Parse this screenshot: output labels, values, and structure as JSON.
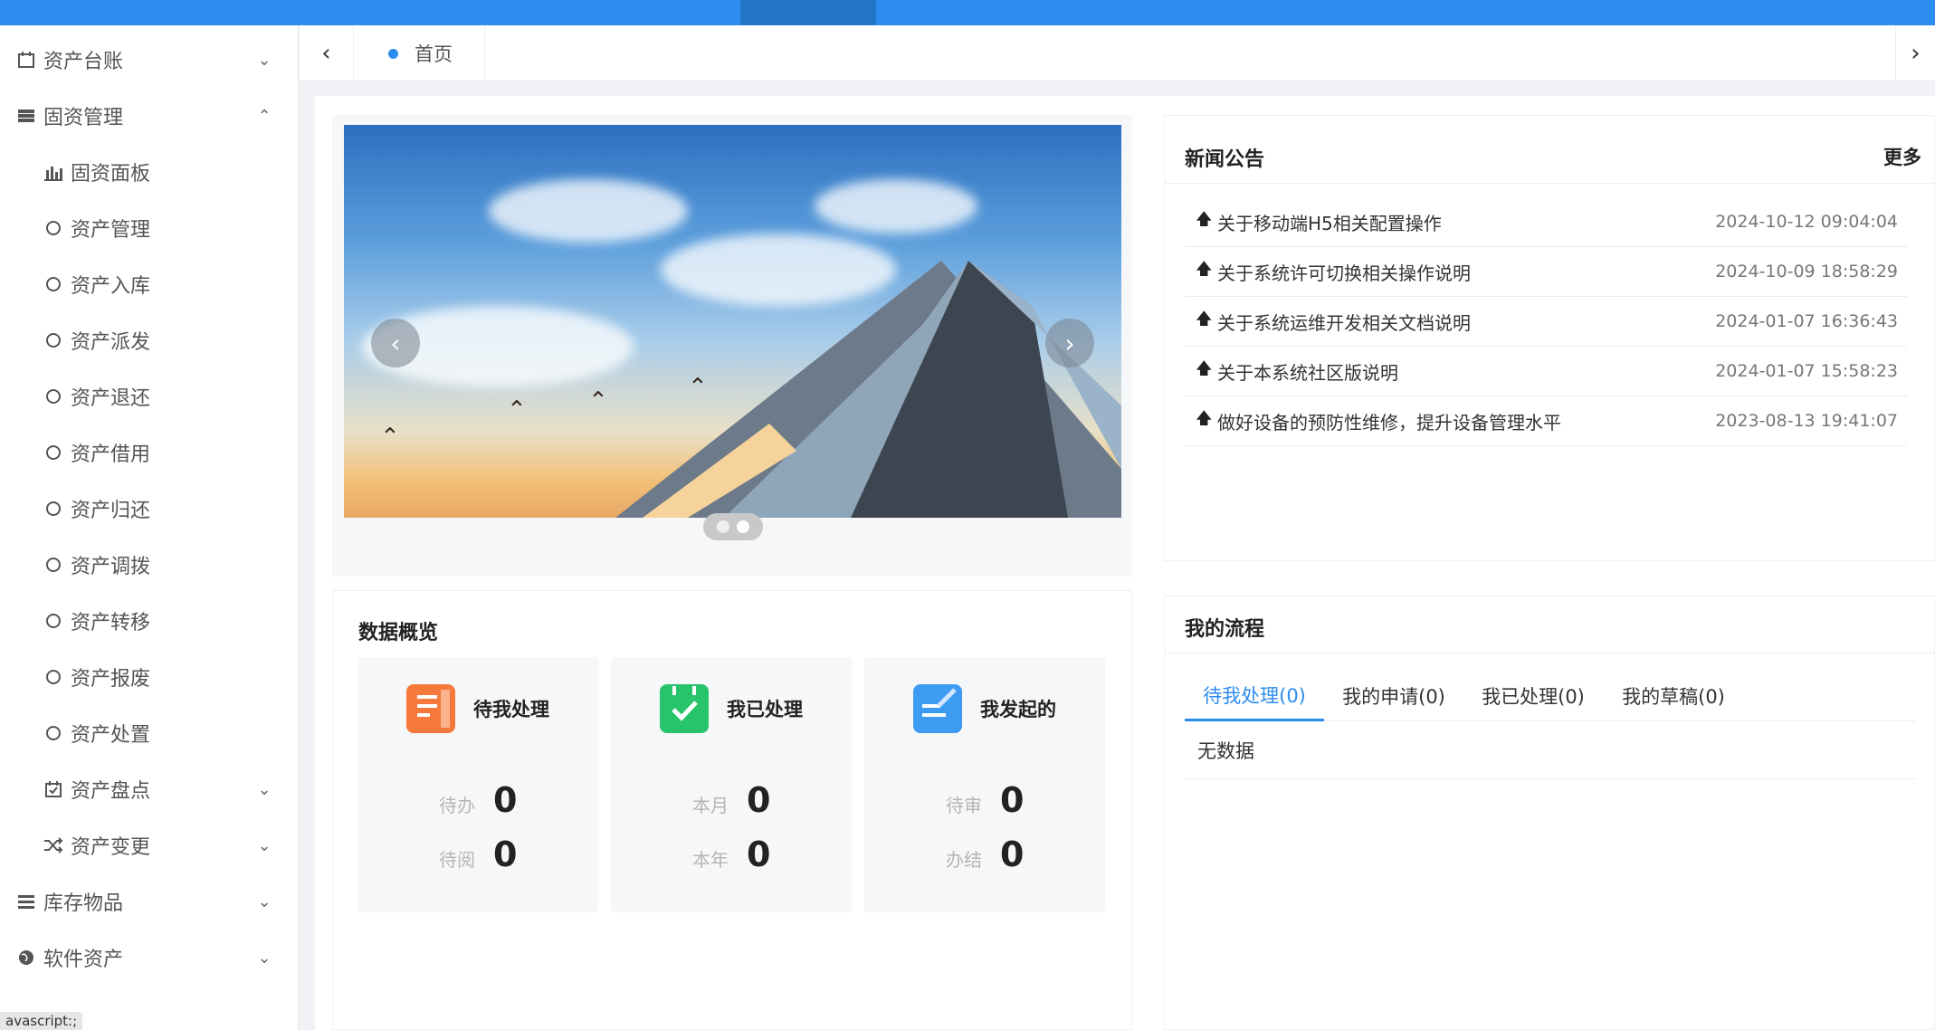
{
  "sidebar": {
    "items": [
      {
        "label": "资产台账",
        "icon": "calendar-icon",
        "expanded": false
      },
      {
        "label": "固资管理",
        "icon": "server-icon",
        "expanded": true
      },
      {
        "label": "固资面板",
        "icon": "bar-chart-icon"
      },
      {
        "label": "资产管理",
        "icon": "circle-icon"
      },
      {
        "label": "资产入库",
        "icon": "circle-icon"
      },
      {
        "label": "资产派发",
        "icon": "circle-icon"
      },
      {
        "label": "资产退还",
        "icon": "circle-icon"
      },
      {
        "label": "资产借用",
        "icon": "circle-icon"
      },
      {
        "label": "资产归还",
        "icon": "circle-icon"
      },
      {
        "label": "资产调拨",
        "icon": "circle-icon"
      },
      {
        "label": "资产转移",
        "icon": "circle-icon"
      },
      {
        "label": "资产报废",
        "icon": "circle-icon"
      },
      {
        "label": "资产处置",
        "icon": "circle-icon"
      },
      {
        "label": "资产盘点",
        "icon": "calendar-check-icon",
        "expanded": false
      },
      {
        "label": "资产变更",
        "icon": "shuffle-icon",
        "expanded": false
      },
      {
        "label": "库存物品",
        "icon": "list-icon",
        "expanded": false
      },
      {
        "label": "软件资产",
        "icon": "globe-icon",
        "expanded": false
      }
    ]
  },
  "tabs": {
    "home_label": "首页"
  },
  "news": {
    "title": "新闻公告",
    "more": "更多",
    "items": [
      {
        "title": "关于移动端H5相关配置操作",
        "date": "2024-10-12 09:04:04"
      },
      {
        "title": "关于系统许可切换相关操作说明",
        "date": "2024-10-09 18:58:29"
      },
      {
        "title": "关于系统运维开发相关文档说明",
        "date": "2024-01-07 16:36:43"
      },
      {
        "title": "关于本系统社区版说明",
        "date": "2024-01-07 15:58:23"
      },
      {
        "title": "做好设备的预防性维修，提升设备管理水平",
        "date": "2023-08-13 19:41:07"
      }
    ]
  },
  "overview": {
    "title": "数据概览",
    "cards": [
      {
        "title": "待我处理",
        "icon": "document-icon",
        "color": "#f5793b",
        "rows": [
          {
            "label": "待办",
            "value": "0"
          },
          {
            "label": "待阅",
            "value": "0"
          }
        ]
      },
      {
        "title": "我已处理",
        "icon": "calendar-check-icon",
        "color": "#27c46b",
        "rows": [
          {
            "label": "本月",
            "value": "0"
          },
          {
            "label": "本年",
            "value": "0"
          }
        ]
      },
      {
        "title": "我发起的",
        "icon": "edit-icon",
        "color": "#3d9bf2",
        "rows": [
          {
            "label": "待审",
            "value": "0"
          },
          {
            "label": "办结",
            "value": "0"
          }
        ]
      }
    ]
  },
  "flow": {
    "title": "我的流程",
    "tabs": [
      "待我处理(0)",
      "我的申请(0)",
      "我已处理(0)",
      "我的草稿(0)"
    ],
    "empty": "无数据"
  },
  "status_bar": "avascript:;",
  "colors": {
    "primary": "#2d8cf0"
  }
}
